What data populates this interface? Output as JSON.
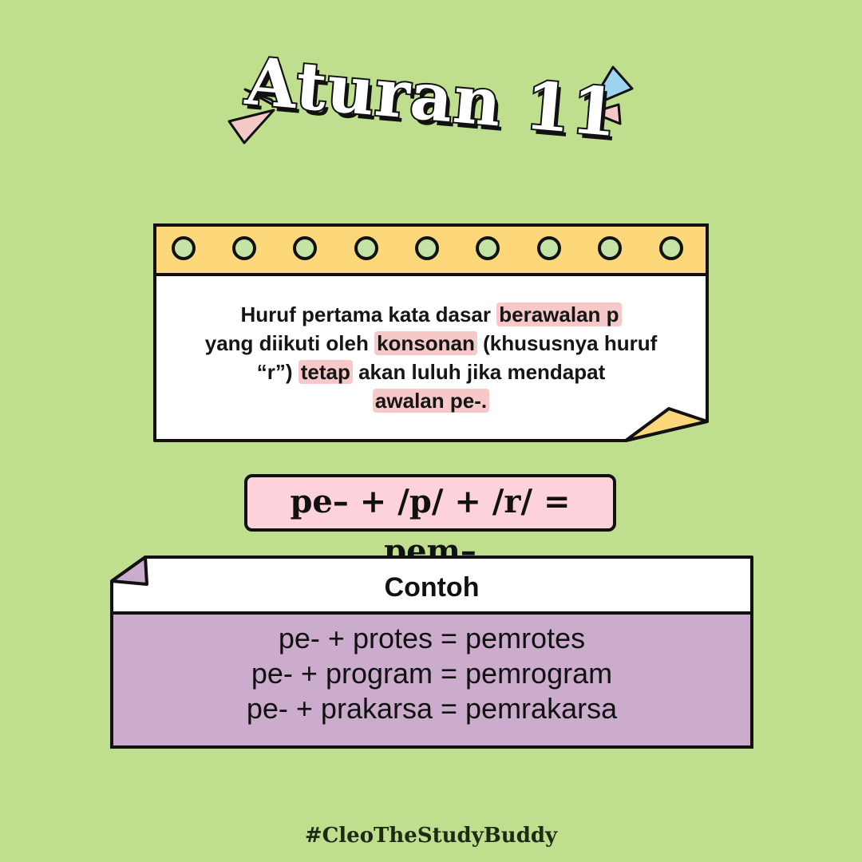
{
  "title": "Aturan 11",
  "colors": {
    "background": "#bfdf8f",
    "outline": "#111111",
    "yellow": "#fcd87a",
    "highlight": "#f7c8c8",
    "pink": "#fdd2da",
    "purple": "#ccaccd",
    "blue": "#9ed4f0",
    "light_green": "#c5e3a4"
  },
  "decorations": [
    "blue-triangle-icon",
    "pink-triangle-icon",
    "binder-ring-icon",
    "folded-corner-icon"
  ],
  "rule": {
    "line1_a": "Huruf pertama kata dasar ",
    "line1_hl": "berawalan p",
    "line2_a": "yang diikuti oleh ",
    "line2_hl": "konsonan",
    "line2_b": " (khususnya huruf",
    "line3_a": "“r”) ",
    "line3_hl": "tetap",
    "line3_b": " akan luluh jika mendapat",
    "line4_hl": "awalan pe-."
  },
  "formula": "pe– + /p/ + /r/ = pem–",
  "example": {
    "header": "Contoh",
    "items": [
      "pe- + protes = pemrotes",
      "pe- + program = pemrogram",
      "pe- + prakarsa = pemrakarsa"
    ]
  },
  "footer": {
    "hashtag": "#CleoTheStudyBuddy"
  }
}
